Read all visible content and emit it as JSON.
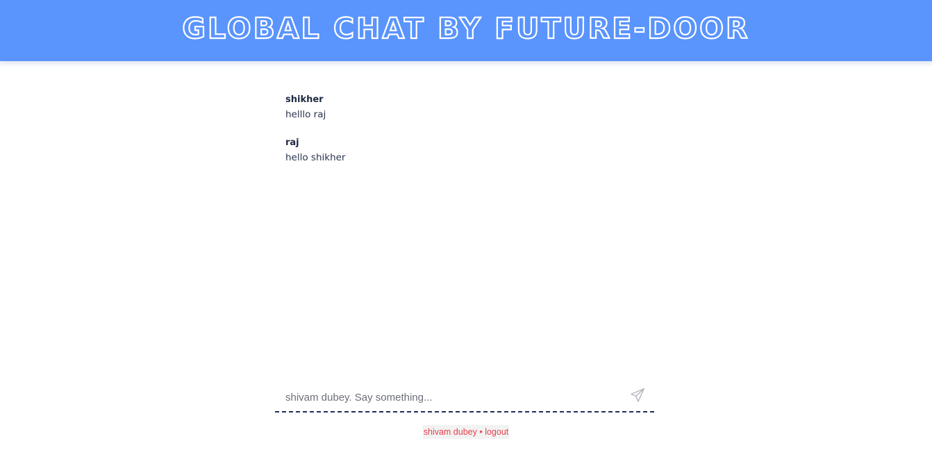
{
  "header": {
    "title": "GLOBAL CHAT BY FUTURE-DOOR"
  },
  "messages": [
    {
      "user": "shikher",
      "text": "helllo raj"
    },
    {
      "user": "raj",
      "text": "hello shikher"
    }
  ],
  "composer": {
    "placeholder": "shivam dubey. Say something...",
    "value": "",
    "send_icon": "paper-plane-icon"
  },
  "footer": {
    "username": "shivam dubey",
    "separator": "•",
    "logout_label": "logout"
  },
  "colors": {
    "header_bg": "#5a94fd",
    "accent_red": "#e5414c",
    "text_dark": "#1f2940",
    "dash_border": "#1f2e5a"
  }
}
